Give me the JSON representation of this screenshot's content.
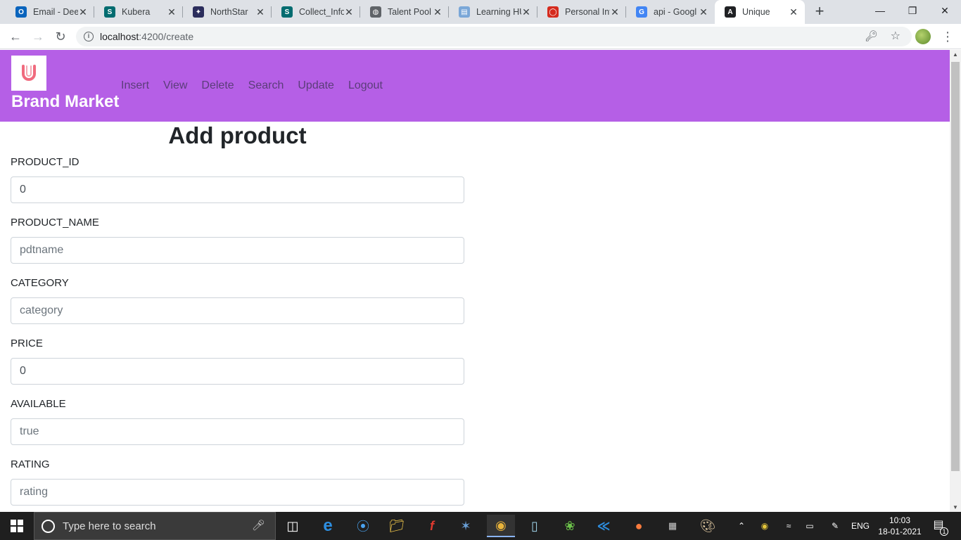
{
  "browser": {
    "tabs": [
      {
        "title": "Email - Dee",
        "favicon": "outlook-icon",
        "color": "#0a64bd",
        "glyph": "O"
      },
      {
        "title": "Kubera",
        "favicon": "sharepoint-icon",
        "color": "#036c70",
        "glyph": "S"
      },
      {
        "title": "NorthStar",
        "favicon": "northstar-icon",
        "color": "#2b2d5c",
        "glyph": "✦"
      },
      {
        "title": "Collect_Info",
        "favicon": "sharepoint-icon",
        "color": "#036c70",
        "glyph": "S"
      },
      {
        "title": "Talent Pool",
        "favicon": "globe-icon",
        "color": "#5f6368",
        "glyph": "◍"
      },
      {
        "title": "Learning HU",
        "favicon": "document-icon",
        "color": "#7aa7d8",
        "glyph": "▤"
      },
      {
        "title": "Personal Inf",
        "favicon": "oracle-icon",
        "color": "#d52b1e",
        "glyph": "◯"
      },
      {
        "title": "api - Googl",
        "favicon": "google-icon",
        "color": "#4285f4",
        "glyph": "G"
      },
      {
        "title": "Unique",
        "favicon": "angular-icon",
        "color": "#202124",
        "glyph": "A"
      }
    ],
    "url_host": "localhost",
    "url_path": ":4200/create"
  },
  "app": {
    "brand": "Brand Market",
    "logo_letter": "U",
    "nav": [
      "Insert",
      "View",
      "Delete",
      "Search",
      "Update",
      "Logout"
    ]
  },
  "form": {
    "title": "Add product",
    "fields": [
      {
        "label": "PRODUCT_ID",
        "value": "0",
        "placeholder": ""
      },
      {
        "label": "PRODUCT_NAME",
        "value": "",
        "placeholder": "pdtname"
      },
      {
        "label": "CATEGORY",
        "value": "",
        "placeholder": "category"
      },
      {
        "label": "PRICE",
        "value": "0",
        "placeholder": ""
      },
      {
        "label": "AVAILABLE",
        "value": "",
        "placeholder": "true"
      },
      {
        "label": "RATING",
        "value": "",
        "placeholder": "rating"
      }
    ]
  },
  "taskbar": {
    "search_placeholder": "Type here to search",
    "language": "ENG",
    "time": "10:03",
    "date": "18-01-2021",
    "notification_count": "1"
  },
  "colors": {
    "header": "#b55fe6",
    "nav_text": "#5b3d7a"
  }
}
